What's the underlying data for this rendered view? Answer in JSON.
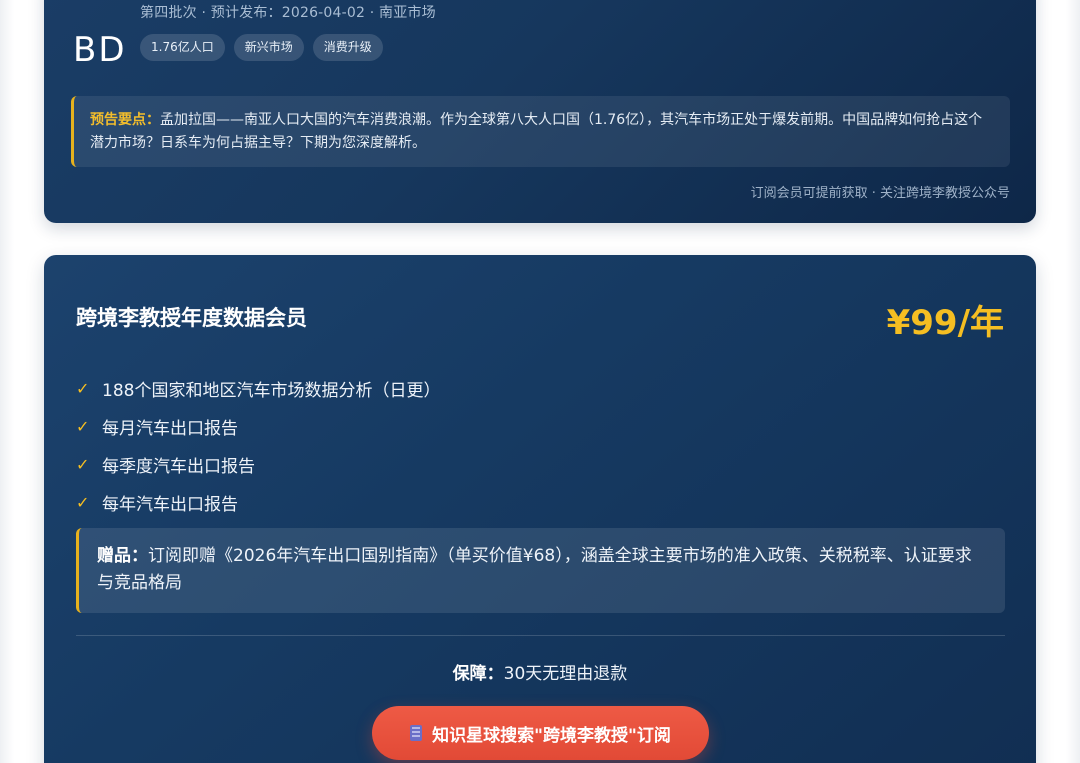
{
  "preview": {
    "meta": "第四批次 · 预计发布：2026-04-02 · 南亚市场",
    "code": "BD",
    "tags": [
      "1.76亿人口",
      "新兴市场",
      "消费升级"
    ],
    "notice_label": "预告要点：",
    "notice_text": "孟加拉国——南亚人口大国的汽车消费浪潮。作为全球第八大人口国（1.76亿），其汽车市场正处于爆发前期。中国品牌如何抢占这个潜力市场？日系车为何占据主导？下期为您深度解析。",
    "footer": "订阅会员可提前获取 · 关注跨境李教授公众号",
    "accent_color": "#e7b21e"
  },
  "membership": {
    "title": "跨境李教授年度数据会员",
    "price": "¥99/年",
    "check_symbol": "✓",
    "features": [
      "188个国家和地区汽车市场数据分析（日更）",
      "每月汽车出口报告",
      "每季度汽车出口报告",
      "每年汽车出口报告"
    ],
    "gift_label": "赠品：",
    "gift_text": "订阅即赠《2026年汽车出口国别指南》（单买价值¥68），涵盖全球主要市场的准入政策、关税税率、认证要求与竞品格局",
    "guarantee_label": "保障：",
    "guarantee_text": "30天无理由退款",
    "cta_label": "知识星球搜索\"跨境李教授\"订阅",
    "cta_icon": "building-icon",
    "price_color": "#f5be22",
    "cta_color": "#e24a36"
  }
}
